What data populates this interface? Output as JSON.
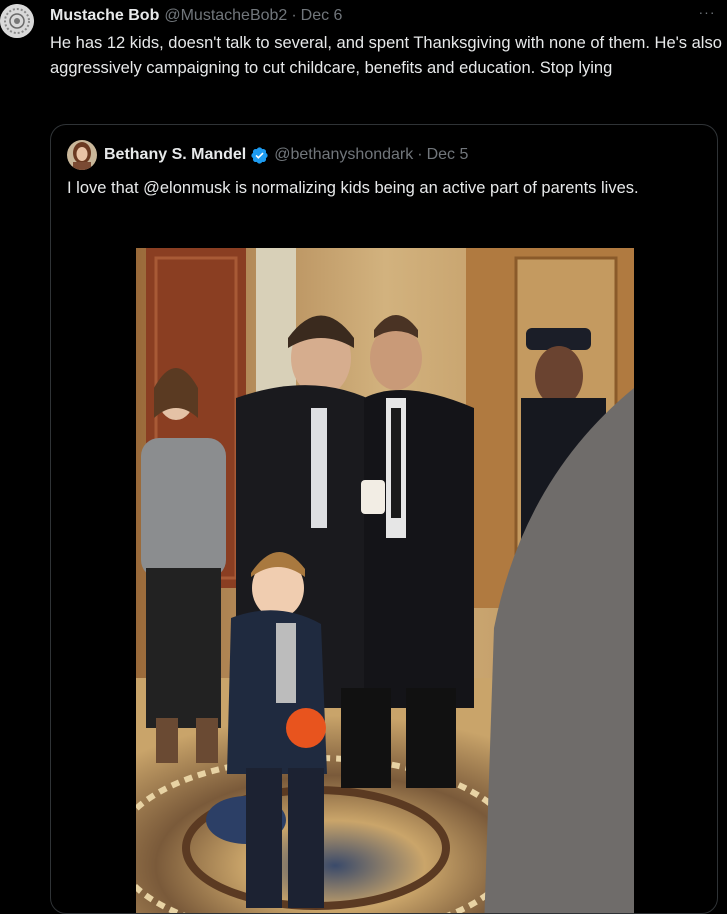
{
  "tweet": {
    "author_name": "Mustache Bob",
    "handle": "@MustacheBob2",
    "separator": "·",
    "date": "Dec 6",
    "more_label": "···",
    "text": "He has 12 kids, doesn't talk to several, and spent Thanksgiving with none of them.  He's also aggressively campaigning to cut childcare, benefits and education. Stop lying"
  },
  "quote": {
    "author_name": "Bethany S. Mandel",
    "handle": "@bethanyshondark",
    "separator": "·",
    "date": "Dec 5",
    "verified": true,
    "text": "I love that @elonmusk is normalizing kids being an active part of parents lives."
  },
  "colors": {
    "background": "#000000",
    "text": "#e7e9ea",
    "muted": "#71767b",
    "border": "#2f3336",
    "verified_blue": "#1d9bf0"
  },
  "icons": {
    "more": "more-horizontal-icon",
    "verified": "verified-badge-icon"
  }
}
